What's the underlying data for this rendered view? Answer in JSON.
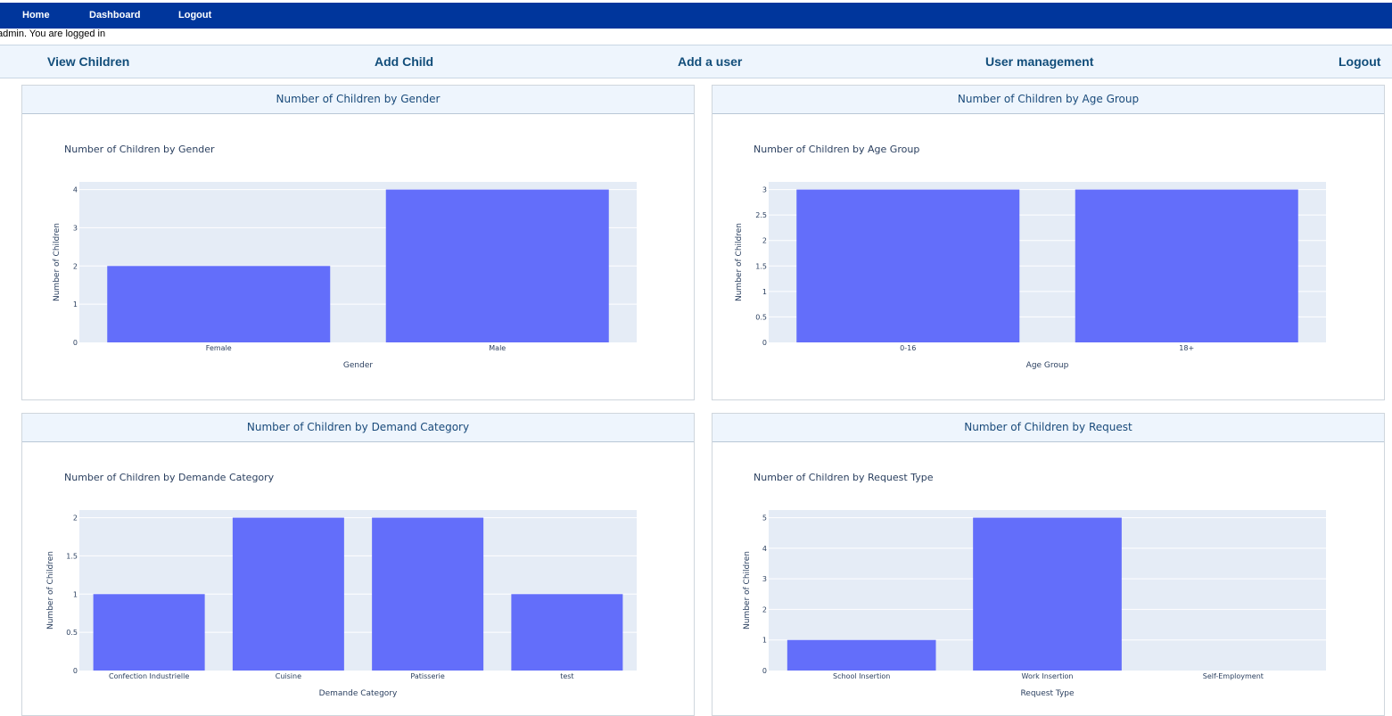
{
  "topnav": {
    "home": "Home",
    "dashboard": "Dashboard",
    "logout": "Logout"
  },
  "login_message": "admin. You are logged in",
  "subnav": {
    "view_children": "View Children",
    "add_child": "Add Child",
    "add_user": "Add a user",
    "user_management": "User management",
    "logout": "Logout"
  },
  "colors": {
    "bar": "#636efa",
    "plot_bg": "#e5ecf6",
    "topbar": "#00369c",
    "panel_header_bg": "#eef5fd"
  },
  "panels": [
    {
      "header": "Number of Children by Gender"
    },
    {
      "header": "Number of Children by Age Group"
    },
    {
      "header": "Number of Children by Demand Category"
    },
    {
      "header": "Number of Children by Request"
    }
  ],
  "chart_data": [
    {
      "type": "bar",
      "title": "Number of Children by Gender",
      "xlabel": "Gender",
      "ylabel": "Number of Children",
      "categories": [
        "Female",
        "Male"
      ],
      "values": [
        2,
        4
      ],
      "ylim": [
        0,
        4.2
      ],
      "yticks": [
        "0",
        "1",
        "2",
        "3",
        "4"
      ]
    },
    {
      "type": "bar",
      "title": "Number of Children by Age Group",
      "xlabel": "Age Group",
      "ylabel": "Number of Children",
      "categories": [
        "0-16",
        "18+"
      ],
      "values": [
        3,
        3
      ],
      "ylim": [
        0,
        3.15
      ],
      "yticks": [
        "0",
        "0.5",
        "1",
        "1.5",
        "2",
        "2.5",
        "3"
      ]
    },
    {
      "type": "bar",
      "title": "Number of Children by Demande Category",
      "xlabel": "Demande Category",
      "ylabel": "Number of Children",
      "categories": [
        "Confection  Industrielle",
        "Cuisine",
        "Patisserie",
        "test"
      ],
      "values": [
        1,
        2,
        2,
        1
      ],
      "ylim": [
        0,
        2.1
      ],
      "yticks": [
        "0",
        "0.5",
        "1",
        "1.5",
        "2"
      ]
    },
    {
      "type": "bar",
      "title": "Number of Children by Request Type",
      "xlabel": "Request Type",
      "ylabel": "Number of Children",
      "categories": [
        "School Insertion",
        "Work Insertion",
        "Self-Employment"
      ],
      "values": [
        1,
        5,
        0
      ],
      "ylim": [
        0,
        5.25
      ],
      "yticks": [
        "0",
        "1",
        "2",
        "3",
        "4",
        "5"
      ]
    }
  ]
}
